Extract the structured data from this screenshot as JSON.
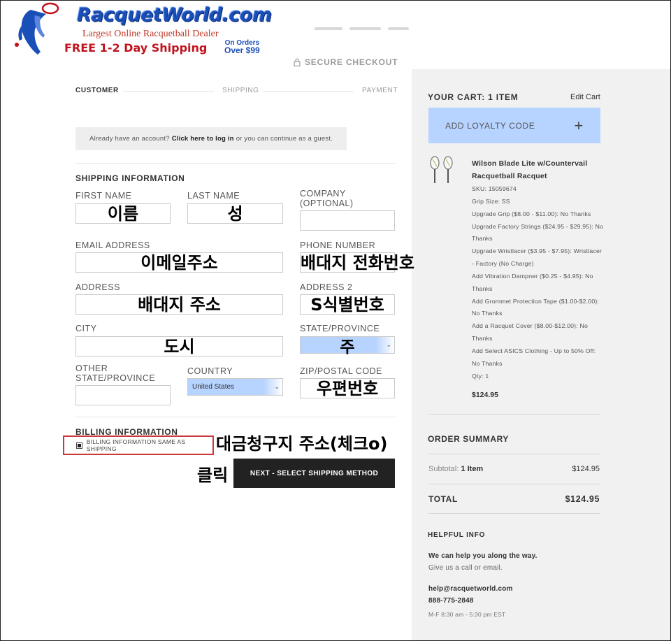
{
  "logo": {
    "brand": "RacquetWorld.com",
    "tagline": "Largest Online Racquetball Dealer",
    "shipping": "FREE 1-2 Day Shipping",
    "orders_line1": "On Orders",
    "orders_line2": "Over $99"
  },
  "secure_checkout": "SECURE CHECKOUT",
  "steps": [
    "CUSTOMER",
    "SHIPPING",
    "PAYMENT"
  ],
  "login": {
    "before": "Already have an account?",
    "link": "Click here to log in",
    "after": "or you can continue as a guest."
  },
  "shipping_info": {
    "title": "SHIPPING INFORMATION",
    "first_name": {
      "label": "FIRST NAME",
      "annotation": "이름"
    },
    "last_name": {
      "label": "LAST NAME",
      "annotation": "성"
    },
    "company": {
      "label_line1": "COMPANY",
      "label_line2": "(OPTIONAL)"
    },
    "email": {
      "label": "EMAIL ADDRESS",
      "annotation": "이메일주소"
    },
    "phone": {
      "label": "PHONE NUMBER",
      "annotation": "배대지 전화번호"
    },
    "address": {
      "label": "ADDRESS",
      "annotation": "배대지 주소"
    },
    "address2": {
      "label": "ADDRESS 2",
      "annotation": "S식별번호"
    },
    "city": {
      "label": "CITY",
      "annotation": "도시"
    },
    "state": {
      "label": "STATE/PROVINCE",
      "annotation": "주"
    },
    "other_state": {
      "label_line1": "OTHER",
      "label_line2": "STATE/PROVINCE"
    },
    "country": {
      "label": "COUNTRY",
      "value": "United States"
    },
    "zip": {
      "label": "ZIP/POSTAL CODE",
      "annotation": "우편번호"
    }
  },
  "billing": {
    "title": "BILLING INFORMATION",
    "checkbox_label": "BILLING INFORMATION SAME AS SHIPPING",
    "checked": true,
    "annotation": "대금청구지 주소(체크o)"
  },
  "next_button": {
    "label": "NEXT - SELECT SHIPPING METHOD",
    "annotation": "클릭"
  },
  "cart": {
    "title": "YOUR CART: 1 ITEM",
    "edit_label": "Edit Cart",
    "loyalty_label": "ADD LOYALTY CODE",
    "product": {
      "name": "Wilson Blade Lite w/Countervail Racquetball Racquet",
      "options": [
        "SKU: 15059674",
        "Grip Size: SS",
        "Upgrade Grip ($8.00 - $11.00): No Thanks",
        "Upgrade Factory Strings ($24.95 - $29.95): No Thanks",
        "Upgrade Wristlacer ($3.95 - $7.95): Wristlacer - Factory (No Charge)",
        "Add Vibration Dampner ($0.25 - $4.95): No Thanks",
        "Add Grommet Protection Tape ($1.00-$2.00): No Thanks",
        "Add a Racquet Cover ($8.00-$12.00): No Thanks",
        "Add Select ASICS Clothing - Up to 50% Off: No Thanks",
        "Qty: 1"
      ],
      "price": "$124.95"
    }
  },
  "order_summary": {
    "title": "ORDER SUMMARY",
    "subtotal_label": "Subtotal:",
    "subtotal_items": "1 Item",
    "subtotal_value": "$124.95",
    "total_label": "TOTAL",
    "total_value": "$124.95"
  },
  "help": {
    "title": "HELPFUL INFO",
    "line1": "We can help you along the way.",
    "line2": "Give us a call or email.",
    "email": "help@racquetworld.com",
    "phone": "888-775-2848",
    "hours": "M-F 8:30 am - 5:30 pm EST"
  },
  "colors": {
    "autofill_blue": "#b7d3ff",
    "brand_blue": "#1a4fb8",
    "brand_red": "#c0141d",
    "button_dark": "#222222",
    "highlight_red": "#c8383e"
  },
  "icons": [
    "racquetball-player-logo-icon",
    "lock-icon",
    "chevron-down-icon",
    "plus-icon",
    "racquet-thumbnail-icon",
    "checkbox-icon"
  ]
}
